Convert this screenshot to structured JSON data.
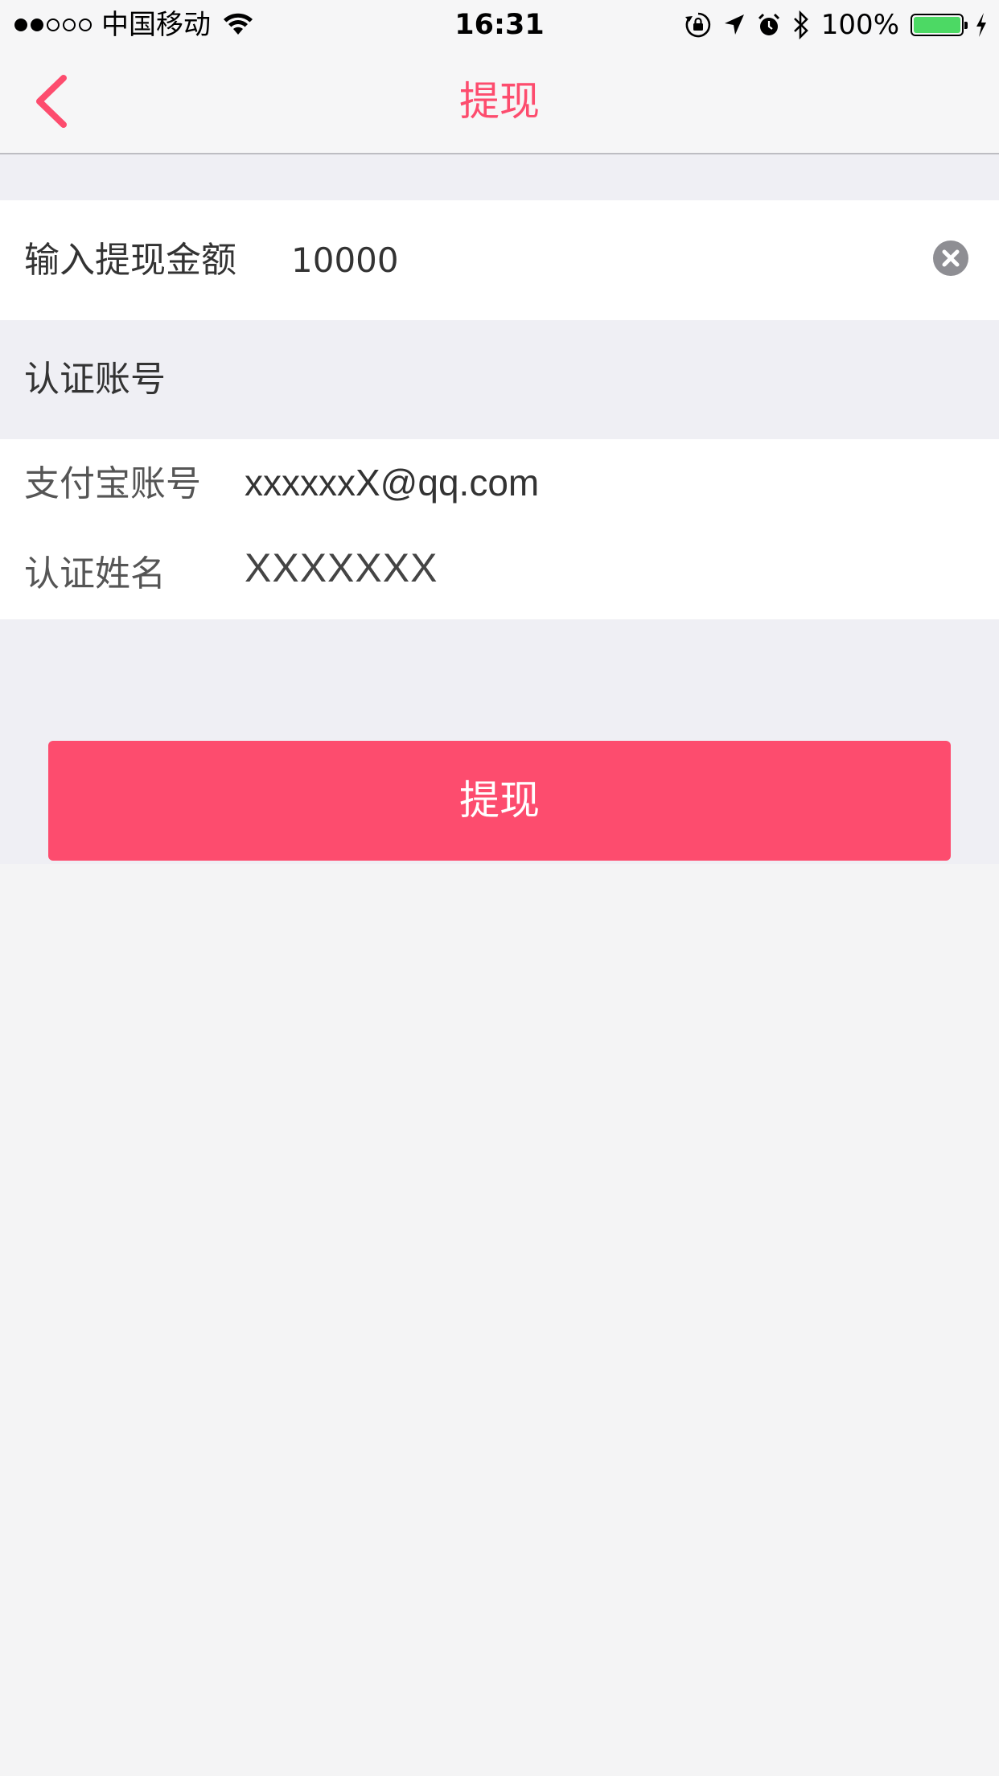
{
  "status_bar": {
    "carrier": "中国移动",
    "time": "16:31",
    "battery_percent": "100%",
    "signal_strength": {
      "filled": 2,
      "total": 5
    },
    "battery_level": 1.0,
    "icons": [
      "wifi-icon",
      "rotation-lock-icon",
      "location-arrow-icon",
      "alarm-icon",
      "bluetooth-icon",
      "battery-icon",
      "charging-bolt-icon"
    ]
  },
  "nav": {
    "title": "提现",
    "back_icon": "chevron-left-icon"
  },
  "amount": {
    "label": "输入提现金额",
    "value": "10000",
    "clear_icon": "clear-circle-icon"
  },
  "account_section": {
    "title": "认证账号",
    "alipay_label": "支付宝账号",
    "alipay_value": "xxxxxxX@qq.com",
    "name_label": "认证姓名",
    "name_value": "XXXXXXX"
  },
  "submit": {
    "label": "提现"
  },
  "colors": {
    "accent": "#fd4c6e",
    "section_bg": "#efeff4",
    "page_bg": "#f4f4f5",
    "battery_green": "#4cd964"
  }
}
